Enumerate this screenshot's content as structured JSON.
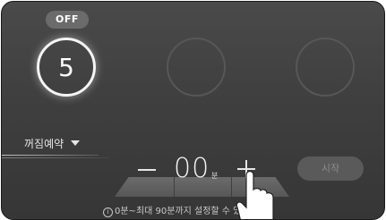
{
  "power": {
    "off_label": "OFF"
  },
  "burners": [
    {
      "value": "5",
      "state": "active"
    },
    {
      "value": "",
      "state": "inactive"
    },
    {
      "value": "",
      "state": "inactive"
    }
  ],
  "timer_tab": {
    "label": "꺼짐예약",
    "icon": "caret-down-icon"
  },
  "timer": {
    "minus_icon": "minus-icon",
    "plus_icon": "plus-icon",
    "minutes": "00",
    "unit": "분"
  },
  "start_button": {
    "label": "시작"
  },
  "info": {
    "icon": "info-circle-icon",
    "text": "0분~최대 90분까지 설정할 수 있습니다."
  },
  "colors": {
    "panel_background": "#3f3f3f",
    "active_ring": "#f4f4f4",
    "inactive_ring": "#575757",
    "start_button_bg": "#5a5a5a"
  },
  "overlay": {
    "icon": "pointing-hand-icon"
  }
}
